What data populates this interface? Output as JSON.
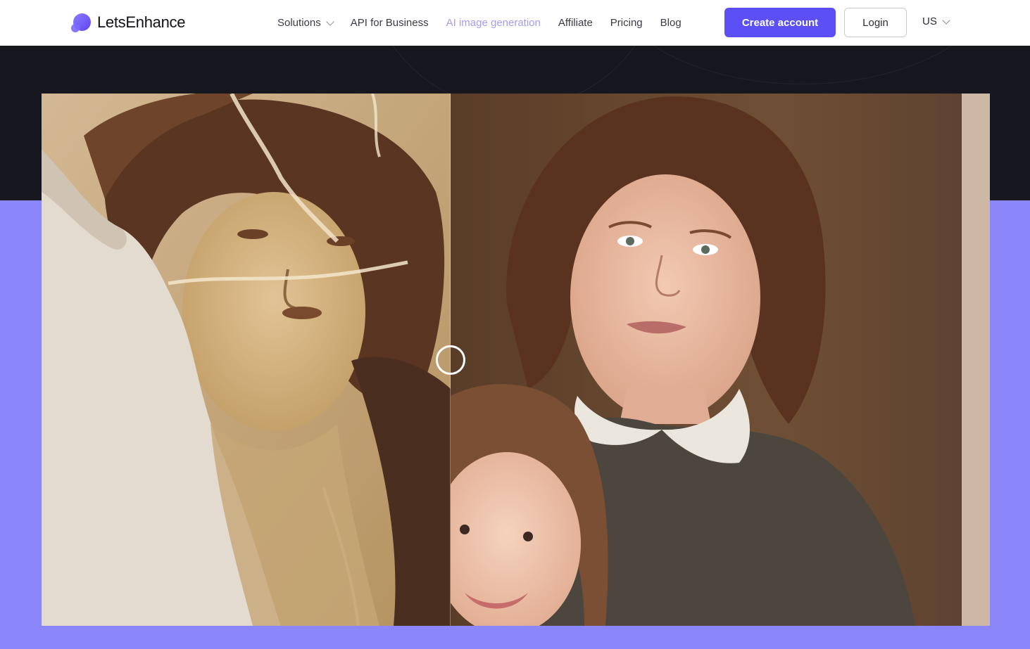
{
  "brand": {
    "name": "LetsEnhance"
  },
  "nav": {
    "items": [
      {
        "label": "Solutions",
        "has_dropdown": true
      },
      {
        "label": "API for Business"
      },
      {
        "label": "AI image generation"
      },
      {
        "label": "Affiliate"
      },
      {
        "label": "Pricing"
      },
      {
        "label": "Blog"
      }
    ]
  },
  "header": {
    "create_account": "Create account",
    "login": "Login",
    "locale": "US"
  },
  "colors": {
    "accent": "#5b4ff5",
    "dark_band": "#16171f",
    "section_bg": "#8b86fa"
  },
  "comparison": {
    "before_image": "damaged sepia portrait photo",
    "after_image": "restored color portrait of woman and child",
    "handle_icon": "slider-handle-icon"
  }
}
